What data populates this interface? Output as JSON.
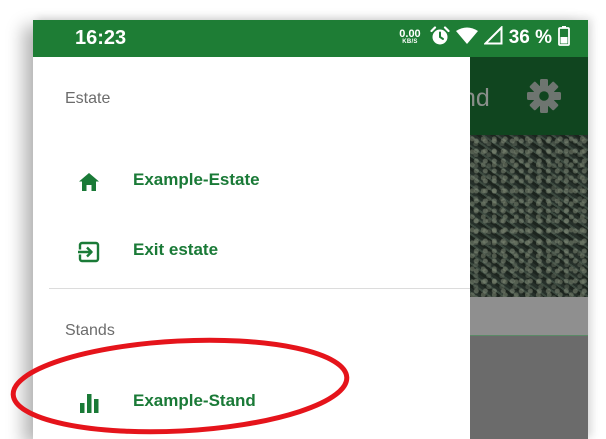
{
  "status_bar": {
    "time": "16:23",
    "net_speed_value": "0.00",
    "net_speed_unit": "KB/S",
    "battery_percent": "36 %",
    "icons": [
      "alarm-clock-icon",
      "wifi-icon",
      "cellular-signal-icon",
      "battery-icon"
    ]
  },
  "background_app": {
    "title_fragment": "nd",
    "settings_icon": "gear-icon"
  },
  "drawer": {
    "estate_section": {
      "header": "Estate",
      "items": [
        {
          "label": "Example-Estate",
          "icon": "home-icon"
        },
        {
          "label": "Exit estate",
          "icon": "exit-icon"
        }
      ]
    },
    "stands_section": {
      "header": "Stands",
      "items": [
        {
          "label": "Example-Stand",
          "icon": "bar-chart-icon"
        }
      ]
    }
  },
  "colors": {
    "status_bar": "#1e7d35",
    "accent_green": "#1a7a37",
    "app_bar": "#10451f",
    "highlight_ellipse": "#e5141b",
    "section_header_text": "#6c6c6c"
  }
}
